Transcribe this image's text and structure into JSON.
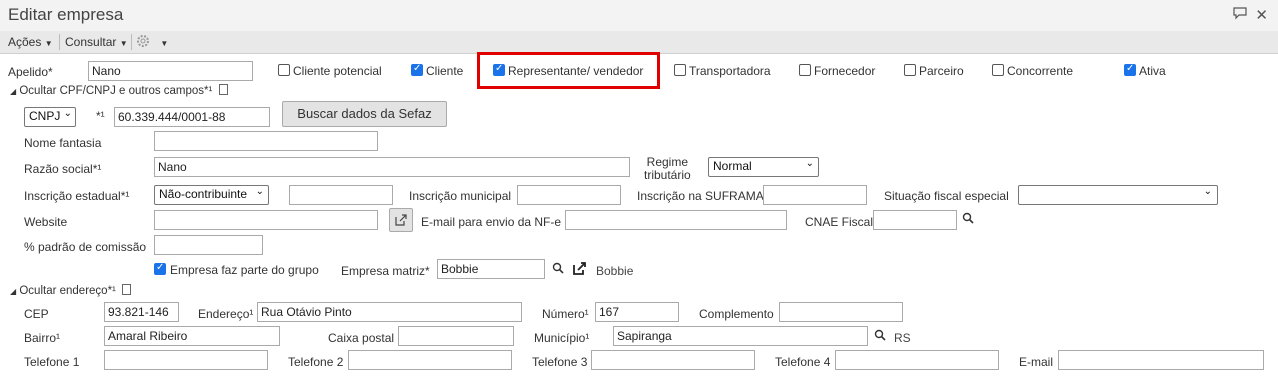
{
  "window": {
    "title": "Editar empresa",
    "icons": [
      "chat-icon",
      "close-icon"
    ]
  },
  "toolbar": {
    "acoes": "Ações",
    "consultar": "Consultar",
    "caret": "▼"
  },
  "flags": {
    "apelido_label": "Apelido*",
    "apelido_value": "Nano",
    "cliente_potencial": {
      "label": "Cliente potencial",
      "checked": false
    },
    "cliente": {
      "label": "Cliente",
      "checked": true
    },
    "representante": {
      "label": "Representante/ vendedor",
      "checked": true
    },
    "transportadora": {
      "label": "Transportadora",
      "checked": false
    },
    "fornecedor": {
      "label": "Fornecedor",
      "checked": false
    },
    "parceiro": {
      "label": "Parceiro",
      "checked": false
    },
    "concorrente": {
      "label": "Concorrente",
      "checked": false
    },
    "ativa": {
      "label": "Ativa",
      "checked": true
    }
  },
  "cpf_section": {
    "header": "Ocultar CPF/CNPJ e outros campos*¹",
    "doc_type": "CNPJ",
    "doc_marker": "*¹",
    "doc_value": "60.339.444/0001-88",
    "buscar_button": "Buscar dados da Sefaz",
    "nome_fantasia_label": "Nome fantasia",
    "nome_fantasia_value": "",
    "razao_social_label": "Razão social*¹",
    "razao_social_value": "Nano",
    "regime_label_1": "Regime",
    "regime_label_2": "tributário",
    "regime_value": "Normal",
    "inscricao_estadual_label": "Inscrição estadual*¹",
    "inscricao_estadual_select": "Não-contribuinte",
    "inscricao_municipal_label": "Inscrição municipal",
    "suframa_label": "Inscrição na SUFRAMA",
    "situacao_fiscal_label": "Situação fiscal especial",
    "situacao_fiscal_value": "",
    "website_label": "Website",
    "email_nfe_label": "E-mail para envio da NF-e",
    "cnae_label": "CNAE Fiscal",
    "comissao_label": "% padrão de comissão",
    "grupo_label": "Empresa faz parte do grupo",
    "grupo_checked": true,
    "matriz_label": "Empresa matriz*",
    "matriz_value": "Bobbie",
    "matriz_link_text": "Bobbie"
  },
  "endereco_section": {
    "header": "Ocultar endereço*¹",
    "cep_label": "CEP",
    "cep_value": "93.821-146",
    "endereco_label": "Endereço¹",
    "endereco_value": "Rua Otávio Pinto",
    "numero_label": "Número¹",
    "numero_value": "167",
    "complemento_label": "Complemento",
    "bairro_label": "Bairro¹",
    "bairro_value": "Amaral Ribeiro",
    "caixa_postal_label": "Caixa postal",
    "municipio_label": "Município¹",
    "municipio_value": "Sapiranga",
    "uf_text": "RS",
    "telefone1_label": "Telefone 1",
    "telefone2_label": "Telefone 2",
    "telefone3_label": "Telefone 3",
    "telefone4_label": "Telefone 4",
    "email_label": "E-mail"
  }
}
